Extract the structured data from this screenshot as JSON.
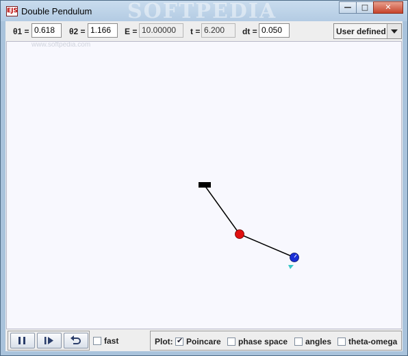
{
  "window": {
    "title": "Double Pendulum",
    "app_icon_text": "EJS",
    "watermark": "SOFTPEDIA",
    "watermark_url": "www.softpedia.com"
  },
  "toolbar": {
    "theta1_label": "θ1 =",
    "theta1_value": "0.618",
    "theta2_label": "θ2 =",
    "theta2_value": "1.166",
    "energy_label": "E =",
    "energy_value": "10.00000",
    "time_label": "t =",
    "time_value": "6.200",
    "dt_label": "dt =",
    "dt_value": "0.050",
    "mode_select": "User defined"
  },
  "colors": {
    "bob1": "#e01010",
    "bob2": "#1a2fd6",
    "pivot": "#000000",
    "velocity_arrow": "#38c8c8",
    "canvas_bg": "#f8f8fe"
  },
  "controls": {
    "pause_icon": "pause-icon",
    "step_icon": "step-forward-icon",
    "reset_icon": "reset-icon",
    "fast_label": "fast",
    "fast_checked": false
  },
  "plot": {
    "label": "Plot:",
    "options": [
      {
        "label": "Poincare",
        "checked": true
      },
      {
        "label": "phase space",
        "checked": false
      },
      {
        "label": "angles",
        "checked": false
      },
      {
        "label": "theta-omega",
        "checked": false
      }
    ]
  }
}
